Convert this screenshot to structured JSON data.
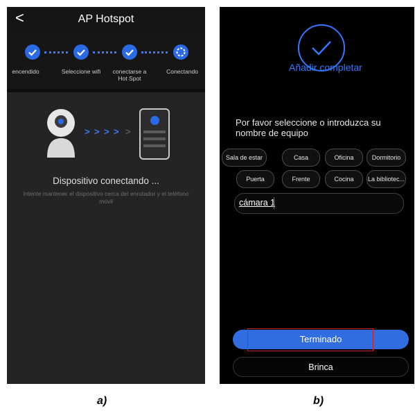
{
  "panel_a": {
    "title": "AP Hotspot",
    "back_glyph": "<",
    "steps": [
      {
        "label": "encendido",
        "icon": "check-icon"
      },
      {
        "label": "Seleccione wifi",
        "icon": "check-icon"
      },
      {
        "label": "conectarse a Hot Spot",
        "icon": "check-icon"
      },
      {
        "label": "Conectando",
        "icon": "loading-icon"
      }
    ],
    "status": "Dispositivo conectando ...",
    "hint": "Intente mantener el dispositivo cerca del enrutador y el teléfono móvil"
  },
  "panel_b": {
    "add_label": "Añadir completar",
    "prompt": "Por favor seleccione o introduzca su nombre de equipo",
    "chips": [
      "Sala de estar",
      "Casa",
      "Oficina",
      "Dormitorio",
      "Puerta",
      "Frente",
      "Cocina",
      "La bibliotec..."
    ],
    "name_value": "cámara 1",
    "done_label": "Terminado",
    "skip_label": "Brinca"
  },
  "captions": {
    "a": "a)",
    "b": "b)"
  },
  "colors": {
    "accent": "#2f6de0",
    "highlight_box": "#d42020",
    "background_a": "#242424",
    "background_b": "#000000"
  }
}
